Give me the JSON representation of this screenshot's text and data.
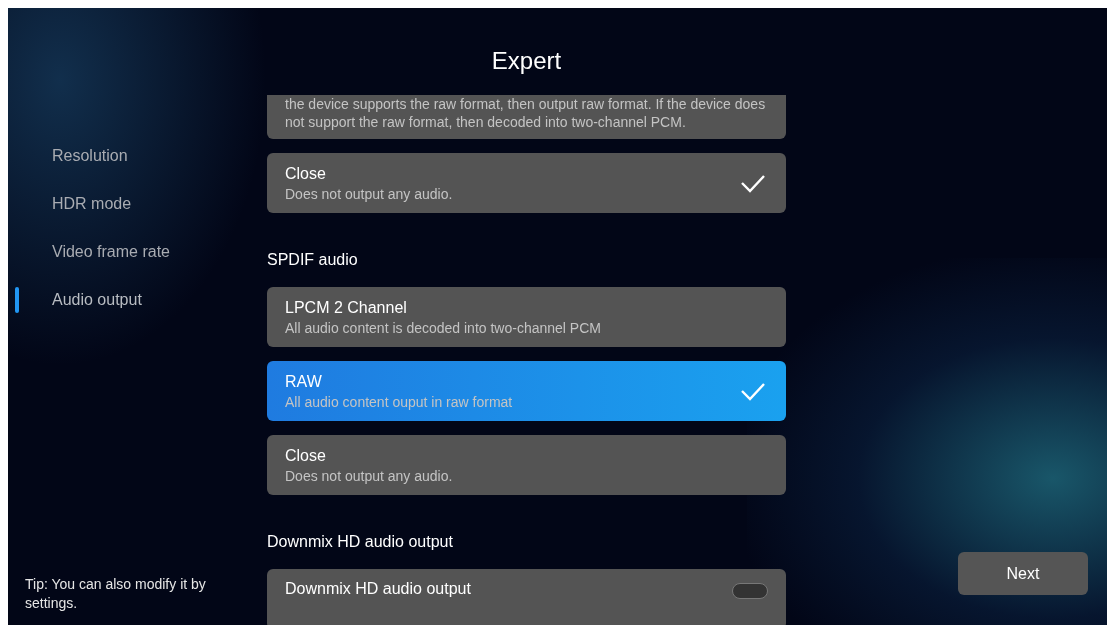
{
  "title": "Expert",
  "sidebar": {
    "items": [
      {
        "label": "Resolution",
        "selected": false
      },
      {
        "label": "HDR mode",
        "selected": false
      },
      {
        "label": "Video frame rate",
        "selected": false
      },
      {
        "label": "Audio output",
        "selected": true
      }
    ]
  },
  "tip": "Tip: You can also modify it by settings.",
  "sections": [
    {
      "options": [
        {
          "kind": "option",
          "description": "the device supports the raw format, then output raw format. If the device does not support the raw format, then decoded into two-channel PCM.",
          "selected": false,
          "focused": false
        },
        {
          "kind": "option",
          "label": "Close",
          "description": "Does not output any audio.",
          "selected": true,
          "focused": false
        }
      ]
    },
    {
      "heading": "SPDIF audio",
      "options": [
        {
          "kind": "option",
          "label": "LPCM 2 Channel",
          "description": "All audio content is decoded into two-channel PCM",
          "selected": false,
          "focused": false
        },
        {
          "kind": "option",
          "label": "RAW",
          "description": "All audio content ouput in raw format",
          "selected": true,
          "focused": true
        },
        {
          "kind": "option",
          "label": "Close",
          "description": "Does not output any audio.",
          "selected": false,
          "focused": false
        }
      ]
    },
    {
      "heading": "Downmix HD audio output",
      "options": [
        {
          "kind": "toggle",
          "label": "Downmix HD audio output",
          "on": false,
          "focused": false
        }
      ]
    }
  ],
  "next_button": "Next"
}
